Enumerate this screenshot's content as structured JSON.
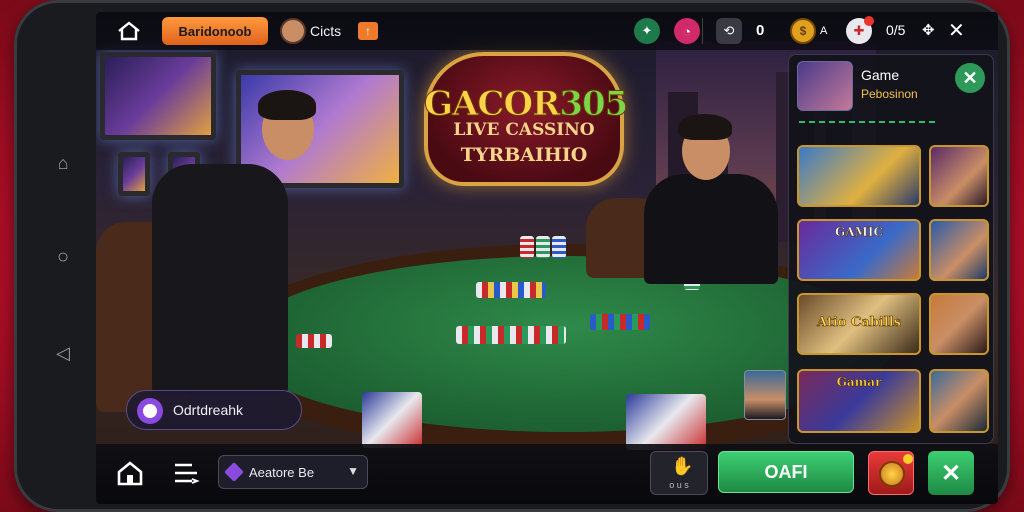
{
  "topbar": {
    "brand_label": "Baridonoob",
    "user_label": "Cicts",
    "badge_label": "↑",
    "credit_label": "0",
    "right_text": "0/5",
    "extra_text": "A"
  },
  "logo": {
    "line1_a": "GACOR",
    "line1_b": "305",
    "line2": "LIVE CASSINO",
    "line3": "TYRBAIHIO"
  },
  "panel": {
    "title": "Game",
    "subtitle": "Pebosinon",
    "tiles": [
      {
        "label": ""
      },
      {
        "label": ""
      },
      {
        "label": "GAMIC"
      },
      {
        "label": ""
      },
      {
        "label": "Atio Cabills"
      },
      {
        "label": ""
      },
      {
        "label": "Gamar"
      },
      {
        "label": ""
      }
    ]
  },
  "chat": {
    "label": "Odrtdreahk"
  },
  "bottombar": {
    "select_label": "Aeatore Be",
    "dark_button_sub": "o u s",
    "primary_label": "OAFI"
  },
  "colors": {
    "accent_green": "#2ebd6a",
    "accent_orange": "#f07a2a",
    "accent_gold": "#d9a441",
    "danger_red": "#d42a2a"
  },
  "icons": {
    "home": "home-icon",
    "close": "close-icon",
    "menu": "menu-icon",
    "chat": "chat-bubble-icon"
  }
}
